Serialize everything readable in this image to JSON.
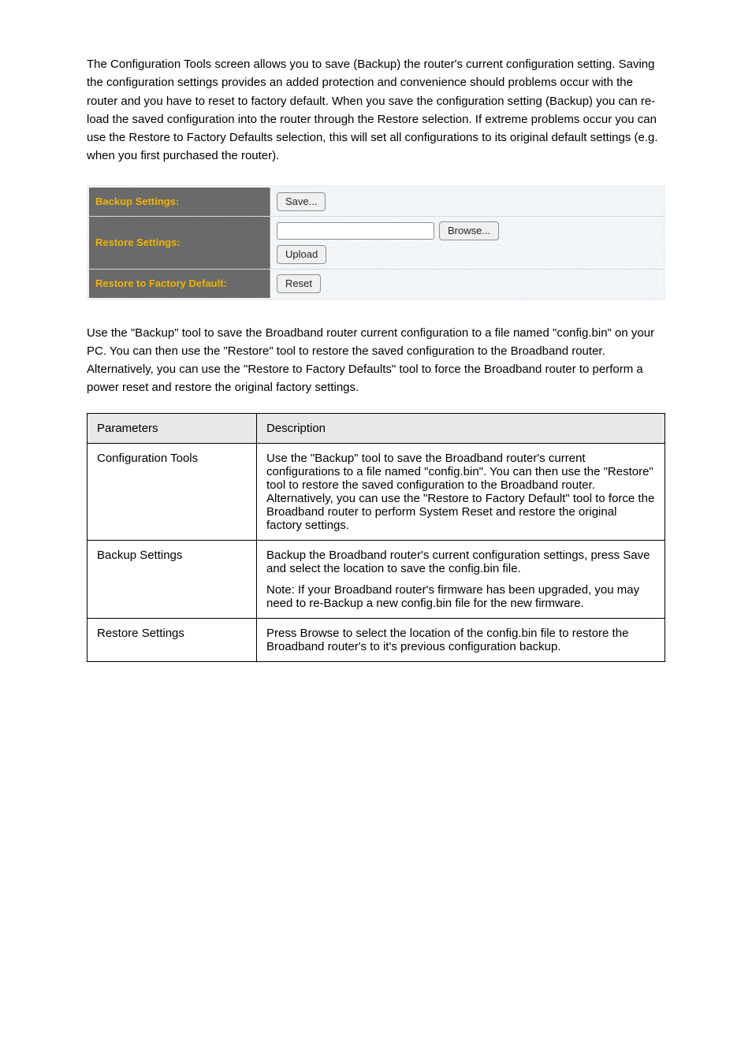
{
  "intro": {
    "p1": "The Configuration Tools screen allows you to save (Backup) the router's current configuration setting. Saving the configuration settings provides an added protection and convenience should problems occur with the router and you have to reset to factory default. When you save the configuration setting (Backup) you can re-load the saved configuration into the router through the Restore selection. If extreme problems occur you can use the Restore to Factory Defaults selection, this will set all configurations to its original default settings (e.g. when you first purchased the router)."
  },
  "panel": {
    "labels": {
      "backup": "Backup Settings:",
      "restore": "Restore Settings:",
      "factory": "Restore to Factory Default:"
    },
    "buttons": {
      "save": "Save...",
      "browse": "Browse...",
      "upload": "Upload",
      "reset": "Reset"
    }
  },
  "post_panel": "Use the \"Backup\" tool to save the Broadband router current configuration to a file named \"config.bin\" on your PC. You can then use the \"Restore\" tool to restore the saved configuration to the Broadband router. Alternatively, you can use the \"Restore to Factory Defaults\" tool to force the Broadband router to perform a power reset and restore the original factory settings.",
  "table": {
    "headers": {
      "param": "Parameters",
      "desc": "Description"
    },
    "rows": [
      {
        "param": "Configuration Tools",
        "desc": [
          "Use the \"Backup\" tool to save the Broadband router's current configurations to a file named \"config.bin\". You can then use the \"Restore\" tool to restore the saved configuration to the Broadband router. Alternatively, you can use the \"Restore to Factory Default\" tool to force the Broadband router to perform System Reset and restore the original factory settings."
        ]
      },
      {
        "param": "Backup Settings",
        "desc": [
          "Backup the Broadband router's current configuration settings, press Save and select the location to save the config.bin file.",
          "Note: If your Broadband router's firmware has been upgraded, you may need to re-Backup a new config.bin file for the new firmware."
        ]
      },
      {
        "param": "Restore Settings",
        "desc": [
          "Press Browse to select the location of the config.bin file to restore the Broadband router's to it's previous configuration backup."
        ]
      }
    ]
  }
}
